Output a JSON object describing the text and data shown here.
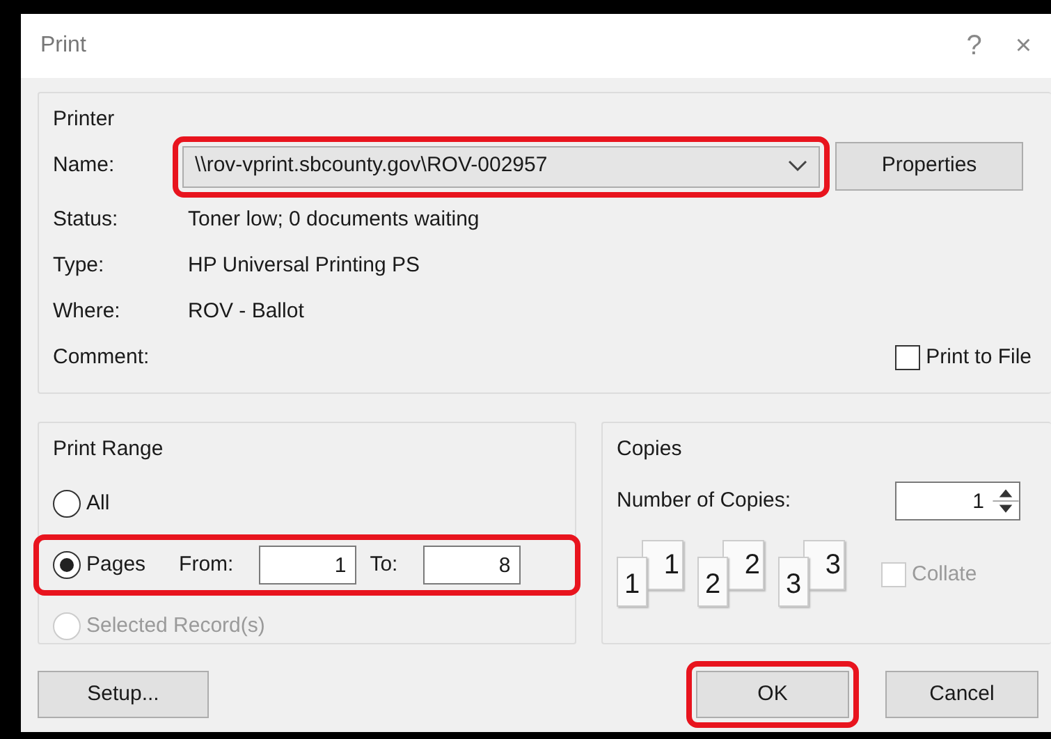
{
  "window": {
    "title": "Print",
    "help": "?",
    "close": "×"
  },
  "printer": {
    "title": "Printer",
    "name": {
      "label": "Name:",
      "value": "\\\\rov-vprint.sbcounty.gov\\ROV-002957",
      "highlighted": true
    },
    "properties_button": "Properties",
    "details": [
      {
        "label": "Status:",
        "value": "Toner low; 0 documents waiting"
      },
      {
        "label": "Type:",
        "value": "HP Universal Printing PS"
      },
      {
        "label": "Where:",
        "value": "ROV - Ballot"
      },
      {
        "label": "Comment:"
      }
    ],
    "print_to_file": {
      "label": "Print to File",
      "checked": false
    }
  },
  "print_range": {
    "title": "Print Range",
    "options": [
      {
        "kind": "plain",
        "label": "All",
        "selected": false,
        "disabled": false
      },
      {
        "kind": "pages",
        "label": "Pages",
        "selected": true,
        "disabled": false,
        "highlighted": true,
        "from_label": "From:",
        "from": "1",
        "to_label": "To:",
        "to": "8"
      },
      {
        "kind": "plain",
        "label": "Selected Record(s)",
        "selected": false,
        "disabled": true
      }
    ]
  },
  "copies": {
    "title": "Copies",
    "number_label": "Number of Copies:",
    "number": "1",
    "collate_pages": [
      {
        "back": "1",
        "front": "1"
      },
      {
        "back": "2",
        "front": "2"
      },
      {
        "back": "3",
        "front": "3"
      }
    ],
    "collate": {
      "label": "Collate",
      "checked": false,
      "disabled": true
    }
  },
  "buttons": [
    {
      "label": "Setup..."
    },
    {
      "label": "OK",
      "highlighted": true
    },
    {
      "label": "Cancel"
    }
  ]
}
